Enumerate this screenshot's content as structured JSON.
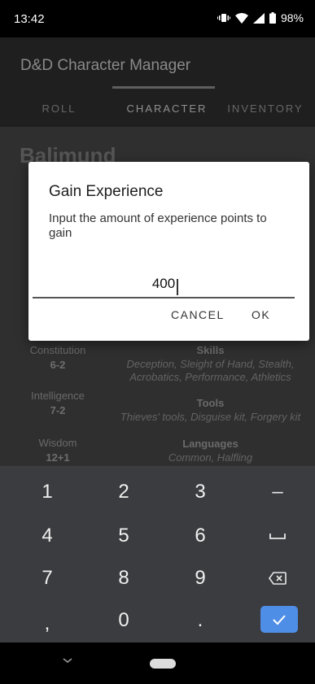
{
  "status_bar": {
    "time": "13:42",
    "battery": "98%"
  },
  "app_bar": {
    "title": "D&D Character Manager",
    "tabs": [
      {
        "label": "ROLL",
        "active": false
      },
      {
        "label": "CHARACTER",
        "active": true
      },
      {
        "label": "INVENTORY",
        "active": false
      }
    ]
  },
  "character": {
    "name": "Balimund",
    "stats": [
      {
        "label": "Constitution",
        "value": "6-2"
      },
      {
        "label": "Intelligence",
        "value": "7-2"
      },
      {
        "label": "Wisdom",
        "value": "12+1"
      }
    ],
    "skills": {
      "heading": "Skills",
      "text": "Deception, Sleight of Hand, Stealth, Acrobatics, Performance, Athletics"
    },
    "tools": {
      "heading": "Tools",
      "text": "Thieves' tools, Disguise kit, Forgery kit"
    },
    "languages": {
      "heading": "Languages",
      "text": "Common, Halfling"
    }
  },
  "dialog": {
    "title": "Gain Experience",
    "message": "Input the amount of experience points to gain",
    "input_value": "400",
    "cancel_label": "CANCEL",
    "ok_label": "OK"
  },
  "keyboard": {
    "rows": [
      [
        "1",
        "2",
        "3",
        "–"
      ],
      [
        "4",
        "5",
        "6",
        "space-key"
      ],
      [
        "7",
        "8",
        "9",
        "backspace-key"
      ],
      [
        ",",
        "0",
        ".",
        "done-key"
      ]
    ],
    "done_color": "#4f8ee6"
  },
  "colors": {
    "scrim_bg": "#3a3a3a",
    "appbar_bg": "#1f1f1f",
    "keyboard_bg": "#3b3c3f"
  }
}
